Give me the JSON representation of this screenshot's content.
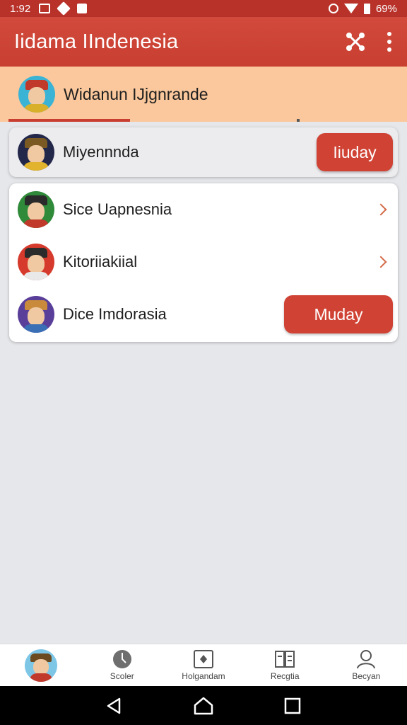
{
  "status_bar": {
    "time": "1:92",
    "battery": "69%"
  },
  "app_bar": {
    "title": "Iidama IIndenesia"
  },
  "user_bar": {
    "name": "Widanun IJjgnrande"
  },
  "featured": {
    "name": "Miyennnda",
    "button_label": "Iiuday"
  },
  "list": [
    {
      "name": "Sice Uapnesnia",
      "action": "chevron"
    },
    {
      "name": "Kitoriiakiial",
      "action": "chevron"
    },
    {
      "name": "Dice Imdorasia",
      "action": "button",
      "button_label": "Muday"
    }
  ],
  "bottom_nav": [
    {
      "label": "",
      "icon": "avatar-icon"
    },
    {
      "label": "Scoler",
      "icon": "badge-icon"
    },
    {
      "label": "Holgandam",
      "icon": "card-icon"
    },
    {
      "label": "Recgtia",
      "icon": "book-icon"
    },
    {
      "label": "Becyan",
      "icon": "person-icon"
    }
  ],
  "colors": {
    "primary": "#c83f32",
    "accent": "#fac89c",
    "chevron": "#d36a47"
  }
}
